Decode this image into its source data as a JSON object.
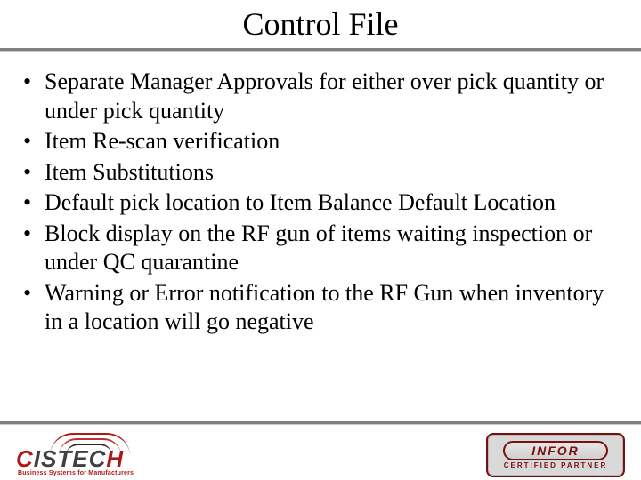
{
  "title": "Control File",
  "bullets": [
    "Separate Manager Approvals for either over pick quantity or under pick quantity",
    "Item Re-scan verification",
    "Item Substitutions",
    "Default pick location to Item Balance Default Location",
    "Block display on the RF gun of items waiting inspection or under QC quarantine",
    "Warning or Error notification to the RF Gun when inventory in a location will go negative"
  ],
  "footer": {
    "left_logo": {
      "name": "CISTECH",
      "tagline": "Business Systems for Manufacturers"
    },
    "right_logo": {
      "name": "INFOR",
      "subtitle": "CERTIFIED PARTNER"
    }
  }
}
